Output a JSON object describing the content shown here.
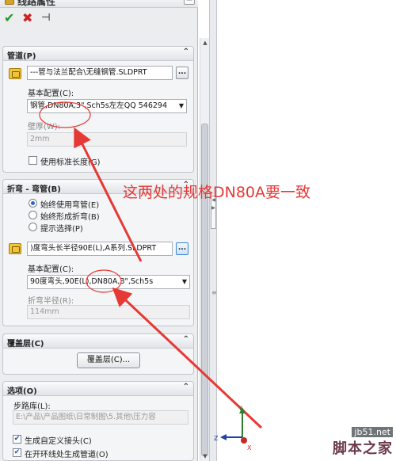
{
  "header": {
    "title": "线路属性"
  },
  "actions": {
    "ok": "✔",
    "cancel": "✖",
    "pin": "⊣"
  },
  "pipe": {
    "title": "管道(P)",
    "file": "---管与法兰配合\\无缝钢管.SLDPRT",
    "browse": "...",
    "config_label": "基本配置(C):",
    "config_value": "钢管,DN80A,3\",Sch5s左左QQ 546294",
    "wall_label": "壁厚(W):",
    "wall_value": "2mm",
    "use_std_label": "使用标准长度(G)"
  },
  "bend": {
    "title": "折弯 - 弯管(B)",
    "opt1": "始终使用弯管(E)",
    "opt2": "始终形成折弯(B)",
    "opt3": "提示选择(P)",
    "file": ")度弯头长半径90E(L),A系列.SLDPRT",
    "browse": "...",
    "config_label": "基本配置(C):",
    "config_value": "90度弯头,90E(L),DN80A,3\",Sch5s",
    "radius_label": "折弯半径(R):",
    "radius_value": "114mm"
  },
  "cover": {
    "title": "覆盖层(C)",
    "button": "覆盖层(C)..."
  },
  "options": {
    "title": "选项(O)",
    "lib_label": "步路库(L):",
    "lib_value": "E:\\产品\\产品图纸\\日常制图\\5.其他\\压力容",
    "chk1": "生成自定义接头(C)",
    "chk2": "在开环线处生成管道(O)"
  },
  "annotation": "这两处的规格DN80A要一致",
  "triad": {
    "x": "X",
    "y": "Y",
    "z": "Z"
  },
  "watermark": {
    "line1": "jb51.net",
    "line2": "脚本之家"
  },
  "colors": {
    "annotation": "#e53935",
    "ok": "#1f9a2a",
    "cancel": "#d11f1f"
  }
}
